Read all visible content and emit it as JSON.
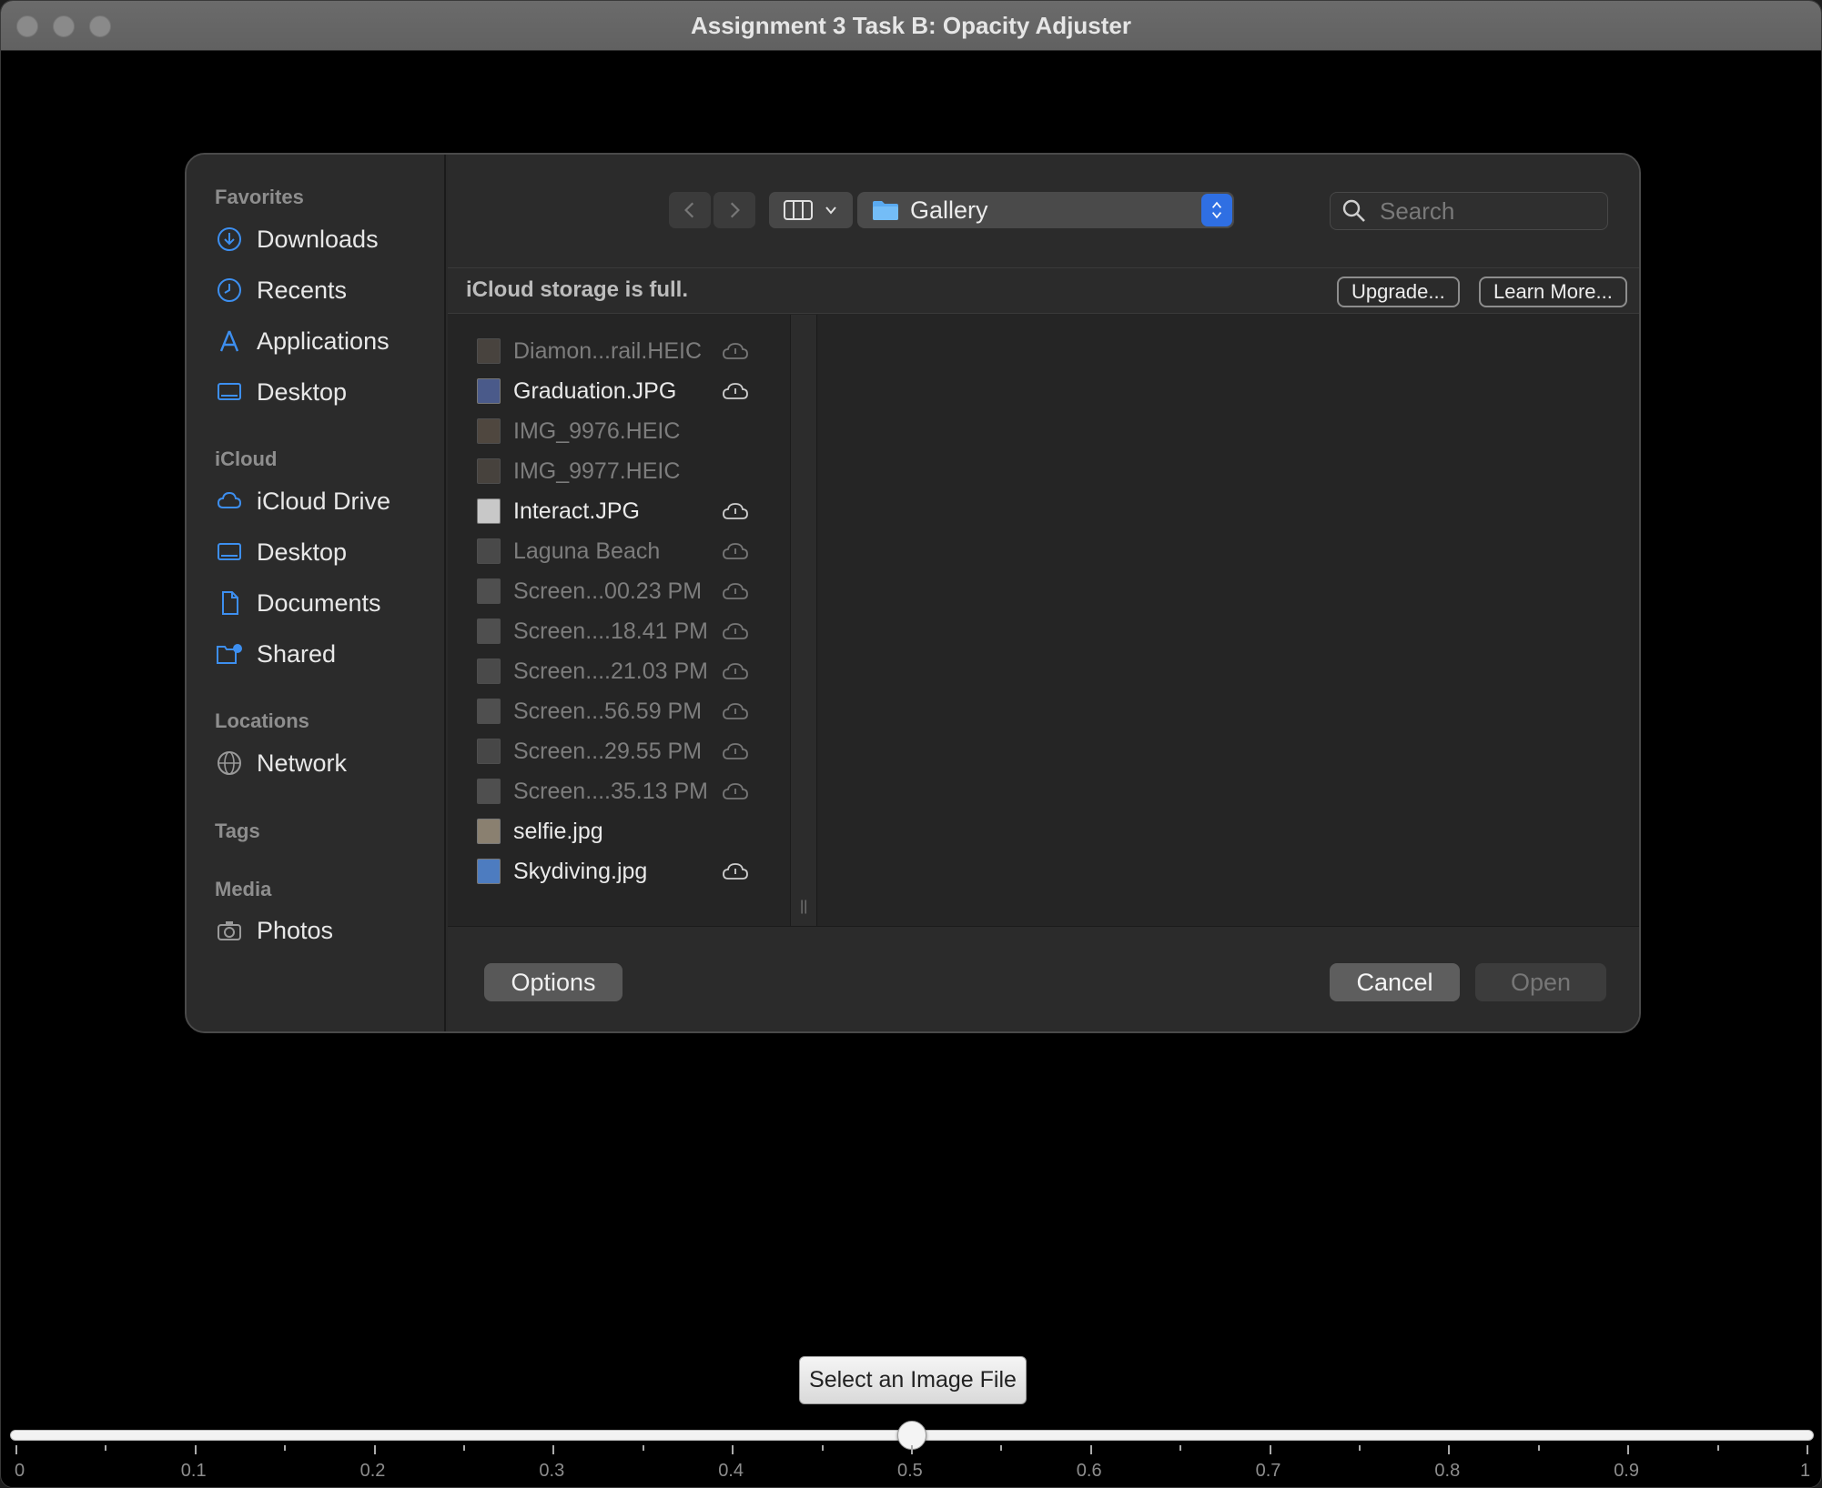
{
  "window": {
    "title": "Assignment 3 Task B: Opacity Adjuster"
  },
  "sidebar": {
    "sections": [
      {
        "title": "Favorites",
        "items": [
          {
            "label": "Downloads",
            "icon": "download-icon"
          },
          {
            "label": "Recents",
            "icon": "clock-icon"
          },
          {
            "label": "Applications",
            "icon": "applications-icon"
          },
          {
            "label": "Desktop",
            "icon": "desktop-icon"
          }
        ]
      },
      {
        "title": "iCloud",
        "items": [
          {
            "label": "iCloud Drive",
            "icon": "cloud-icon"
          },
          {
            "label": "Desktop",
            "icon": "desktop-icon"
          },
          {
            "label": "Documents",
            "icon": "document-icon"
          },
          {
            "label": "Shared",
            "icon": "shared-folder-icon"
          }
        ]
      },
      {
        "title": "Locations",
        "items": [
          {
            "label": "Network",
            "icon": "globe-icon"
          }
        ]
      },
      {
        "title": "Tags",
        "items": []
      },
      {
        "title": "Media",
        "items": [
          {
            "label": "Photos",
            "icon": "camera-icon"
          }
        ]
      }
    ]
  },
  "toolbar": {
    "location": "Gallery",
    "search_placeholder": "Search"
  },
  "icloud_banner": {
    "message": "iCloud storage is full.",
    "upgrade_label": "Upgrade...",
    "learn_more_label": "Learn More..."
  },
  "files": [
    {
      "name": "Diamon...rail.HEIC",
      "enabled": false,
      "cloud": true
    },
    {
      "name": "Graduation.JPG",
      "enabled": true,
      "cloud": true
    },
    {
      "name": "IMG_9976.HEIC",
      "enabled": false,
      "cloud": false
    },
    {
      "name": "IMG_9977.HEIC",
      "enabled": false,
      "cloud": false
    },
    {
      "name": "Interact.JPG",
      "enabled": true,
      "cloud": true
    },
    {
      "name": "Laguna Beach",
      "enabled": false,
      "cloud": true
    },
    {
      "name": "Screen...00.23 PM",
      "enabled": false,
      "cloud": true
    },
    {
      "name": "Screen....18.41 PM",
      "enabled": false,
      "cloud": true
    },
    {
      "name": "Screen....21.03 PM",
      "enabled": false,
      "cloud": true
    },
    {
      "name": "Screen...56.59 PM",
      "enabled": false,
      "cloud": true
    },
    {
      "name": "Screen...29.55 PM",
      "enabled": false,
      "cloud": true
    },
    {
      "name": "Screen....35.13 PM",
      "enabled": false,
      "cloud": true
    },
    {
      "name": "selfie.jpg",
      "enabled": true,
      "cloud": false
    },
    {
      "name": "Skydiving.jpg",
      "enabled": true,
      "cloud": true
    }
  ],
  "footer": {
    "options_label": "Options",
    "cancel_label": "Cancel",
    "open_label": "Open"
  },
  "controls": {
    "select_button_label": "Select an Image File",
    "opacity_slider": {
      "value": 0.5,
      "min": 0,
      "max": 1,
      "tick_labels": [
        "0",
        "0.1",
        "0.2",
        "0.3",
        "0.4",
        "0.5",
        "0.6",
        "0.7",
        "0.8",
        "0.9",
        "1"
      ]
    }
  },
  "colors": {
    "accent": "#2f6fe3",
    "sidebar_icon": "#3d8ff0",
    "window_background": "#000000"
  }
}
